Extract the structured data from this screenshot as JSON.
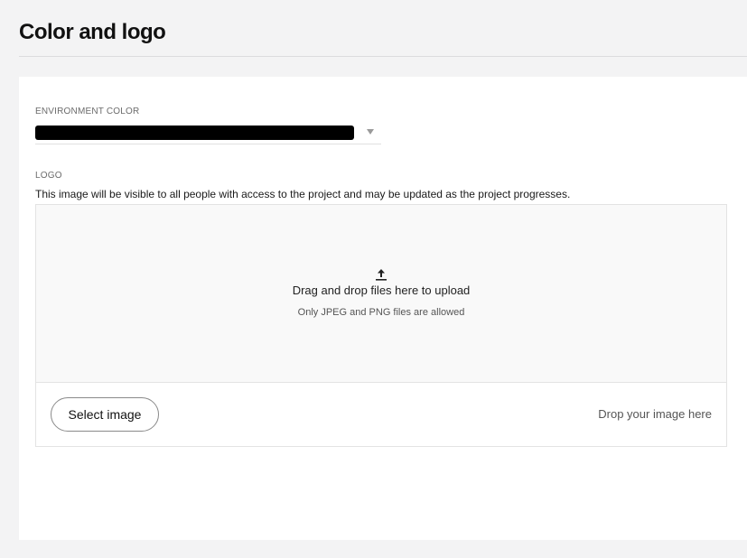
{
  "page": {
    "title": "Color and logo"
  },
  "environment_color": {
    "label": "ENVIRONMENT COLOR",
    "selected_color": "#000000",
    "dropdown_icon": "chevron-down-icon"
  },
  "logo": {
    "label": "LOGO",
    "description": "This image will be visible to all people with access to the project and may be updated as the project progresses.",
    "dropzone": {
      "icon": "upload-icon",
      "title": "Drag and drop files here to upload",
      "hint": "Only JPEG and PNG files are allowed"
    },
    "select_button_label": "Select image",
    "drop_here_text": "Drop your image here"
  },
  "colors": {
    "page_background": "#f3f3f4",
    "card_background": "#ffffff",
    "dropzone_background": "#f9f9f9",
    "border": "#e3e3e3"
  }
}
